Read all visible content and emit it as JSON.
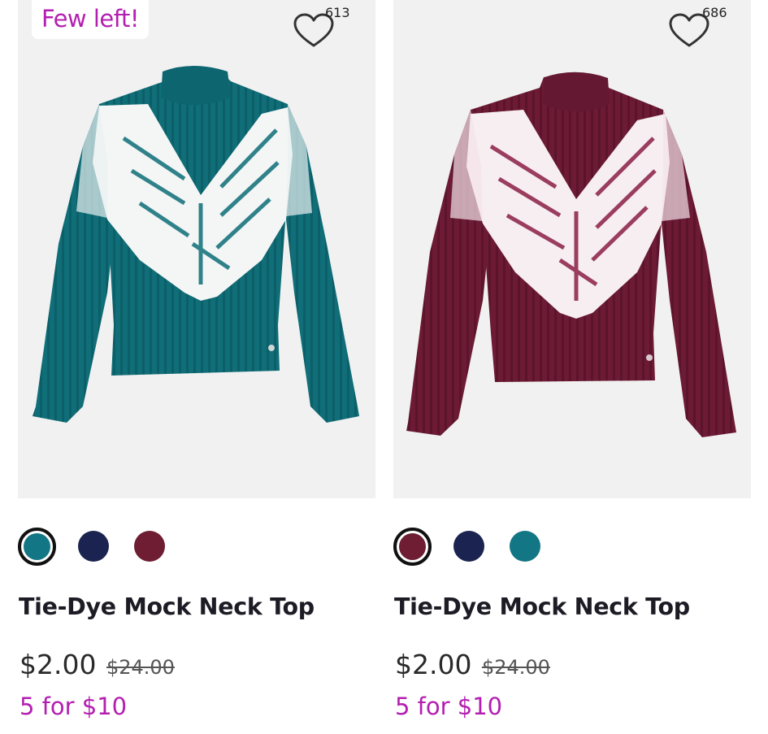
{
  "products": [
    {
      "badge": "Few left!",
      "favorites_count": "613",
      "title": "Tie-Dye Mock Neck Top",
      "price": "$2.00",
      "original_price": "$24.00",
      "promo": "5 for $10",
      "main_color": "#0f6e78",
      "swatches": [
        {
          "color": "#137684",
          "selected": true
        },
        {
          "color": "#1b2450",
          "selected": false
        },
        {
          "color": "#6e1d33",
          "selected": false
        }
      ]
    },
    {
      "badge": "",
      "favorites_count": "686",
      "title": "Tie-Dye Mock Neck Top",
      "price": "$2.00",
      "original_price": "$24.00",
      "promo": "5 for $10",
      "main_color": "#6d1a35",
      "swatches": [
        {
          "color": "#6e1d33",
          "selected": true
        },
        {
          "color": "#1b2450",
          "selected": false
        },
        {
          "color": "#137684",
          "selected": false
        }
      ]
    }
  ],
  "icons": {
    "favorite": "heart-outline-icon"
  }
}
